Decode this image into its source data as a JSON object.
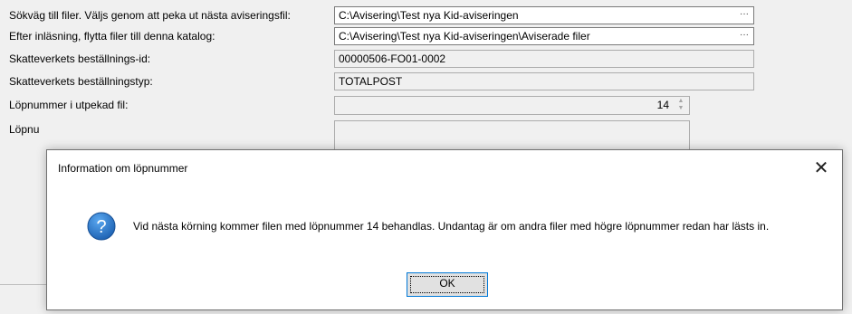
{
  "form": {
    "rows": [
      {
        "label": "Sökväg till filer. Väljs genom att peka ut nästa aviseringsfil:",
        "value": "C:\\Avisering\\Test nya Kid-aviseringen",
        "browse": "···"
      },
      {
        "label": "Efter inläsning, flytta filer till denna katalog:",
        "value": "C:\\Avisering\\Test nya Kid-aviseringen\\Aviserade filer",
        "browse": "···"
      },
      {
        "label": "Skatteverkets beställnings-id:",
        "value": "00000506-FO01-0002"
      },
      {
        "label": "Skatteverkets beställningstyp:",
        "value": "TOTALPOST"
      },
      {
        "label": "Löpnummer i utpekad fil:",
        "value": "14"
      },
      {
        "label": "Löpnu"
      }
    ]
  },
  "dialog": {
    "title": "Information om löpnummer",
    "close": "✕",
    "icon": "question-icon",
    "message": "Vid nästa körning kommer filen med löpnummer 14 behandlas. Undantag är om andra filer med högre löpnummer redan har lästs in.",
    "ok_label": "OK"
  },
  "colors": {
    "icon_blue": "#1b6ec2",
    "focus_border": "#0078d7"
  }
}
